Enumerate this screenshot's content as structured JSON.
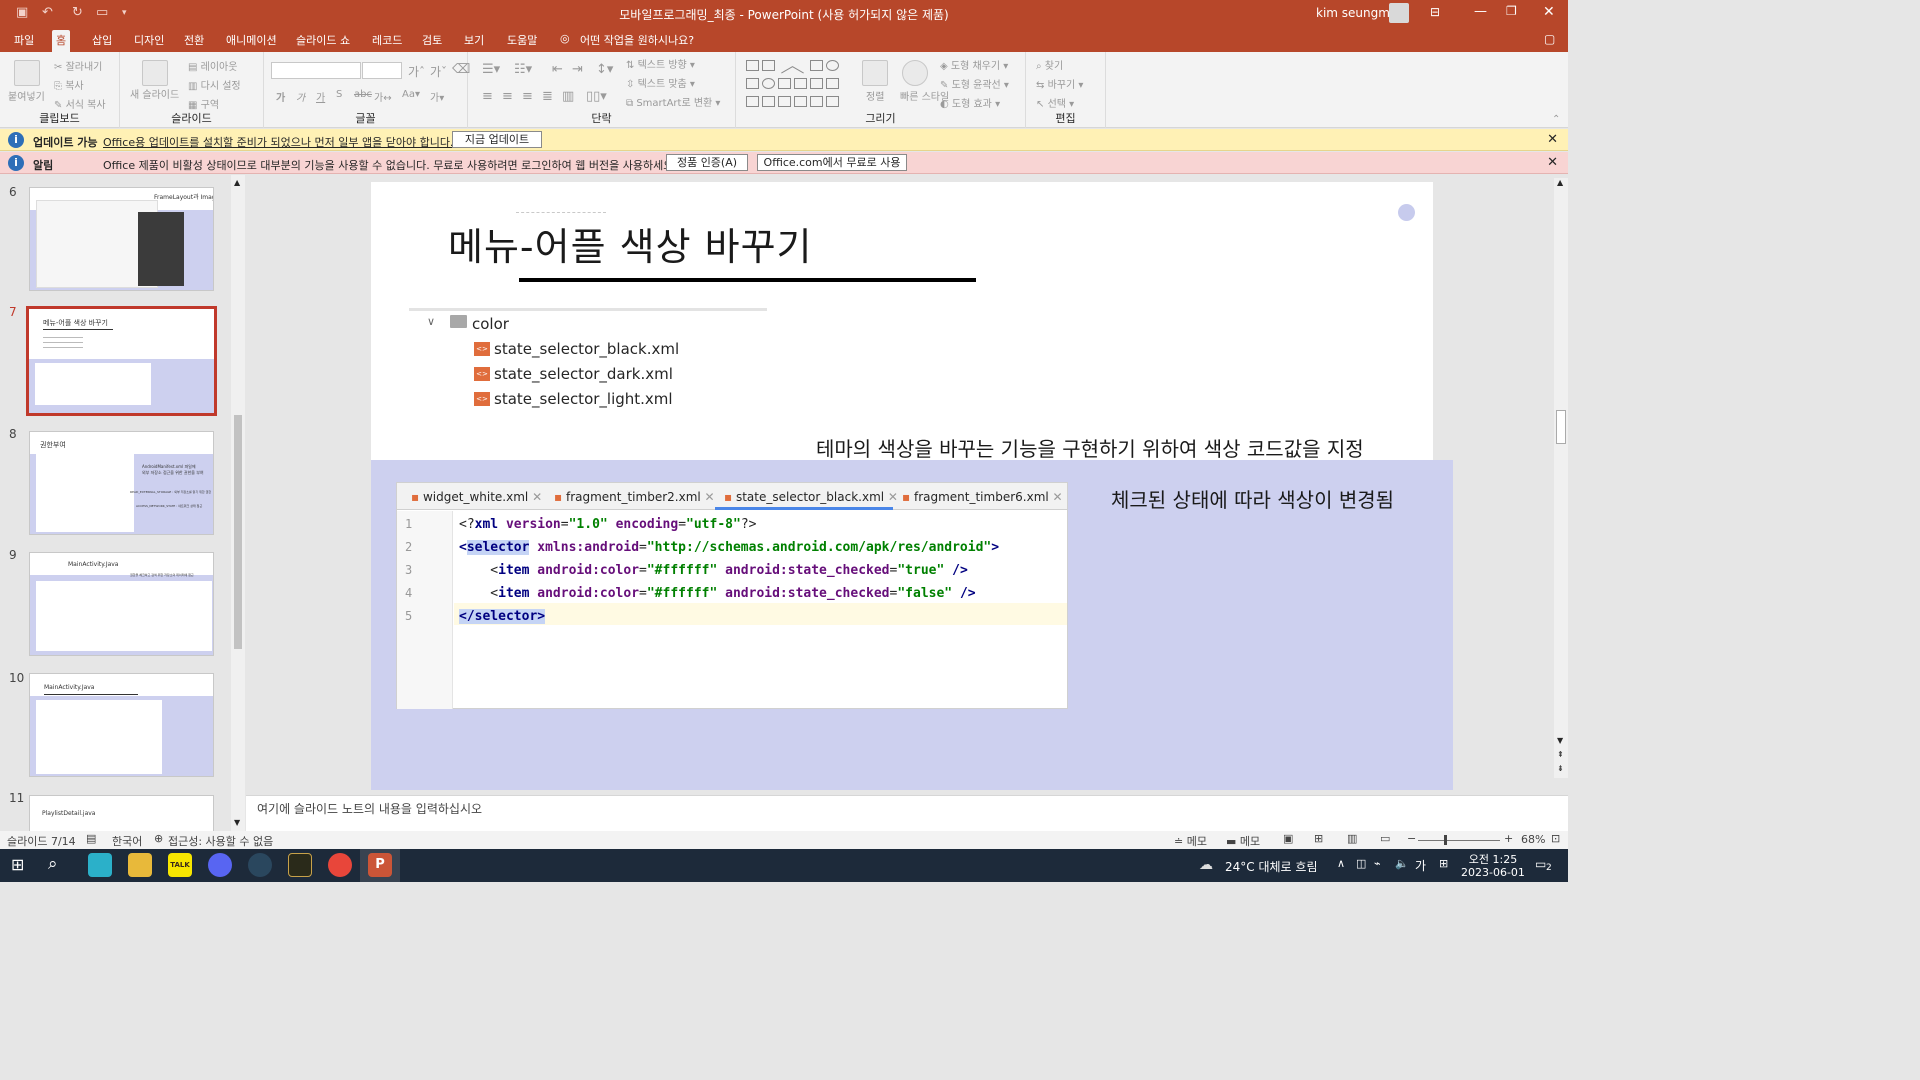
{
  "title_bar": {
    "document": "모바일프로그래밍_최종 - PowerPoint (사용 허가되지 않은 제품)",
    "user": "kim seungmin"
  },
  "menu_tabs": [
    "파일",
    "홈",
    "삽입",
    "디자인",
    "전환",
    "애니메이션",
    "슬라이드 쇼",
    "레코드",
    "검토",
    "보기",
    "도움말"
  ],
  "tell_me": "어떤 작업을 원하시나요?",
  "ribbon": {
    "clipboard": {
      "label": "클립보드",
      "paste": "붙여넣기",
      "cut": "잘라내기",
      "copy": "복사",
      "format": "서식 복사"
    },
    "slides": {
      "label": "슬라이드",
      "new_slide": "새 슬라이드",
      "layout": "레이아웃",
      "reset": "다시 설정",
      "section": "구역"
    },
    "font": {
      "label": "글꼴"
    },
    "paragraph": {
      "label": "단락",
      "text_dir": "텍스트 방향",
      "align_text": "텍스트 맞춤",
      "smartart": "SmartArt로 변환"
    },
    "drawing": {
      "label": "그리기",
      "arrange": "정렬",
      "quick_styles": "빠른 스타일",
      "fill": "도형 채우기",
      "outline": "도형 윤곽선",
      "effects": "도형 효과"
    },
    "editing": {
      "label": "편집",
      "find": "찾기",
      "replace": "바꾸기",
      "select": "선택"
    }
  },
  "update_bar": {
    "title": "업데이트 가능",
    "message": "Office용 업데이트를 설치할 준비가 되었으나 먼저 일부 앱을 닫아야 합니다.",
    "button": "지금 업데이트"
  },
  "alert_bar": {
    "title": "알림",
    "message": "Office 제품이 비활성 상태이므로 대부분의 기능을 사용할 수 없습니다. 무료로 사용하려면 로그인하여 웹 버전을 사용하세요.",
    "button1": "정품 인증(A)",
    "button2": "Office.com에서 무료로 사용"
  },
  "thumbnails": [
    {
      "num": "6",
      "title": "FrameLayout과 ImageView 활용"
    },
    {
      "num": "7",
      "title": "메뉴-어플 색상 바꾸기"
    },
    {
      "num": "8",
      "title": "권한부여",
      "caption1": "AndroidManifest.xml 파일에",
      "caption2": "외부 저장소 접근을 위한 권한을 부여",
      "caption3": "READ_EXTERNAL_STORAGE : 외부 저장소를 읽기 위한 권한",
      "caption4": "ACCESS_NETWORK_STATE : 네트워크 상태 접근"
    },
    {
      "num": "9",
      "title": "MainActivity.Java",
      "caption1": "권한을 체크하고 검색 위한 저장소의 데이터에 접근"
    },
    {
      "num": "10",
      "title": "MainActivity.Java"
    },
    {
      "num": "11",
      "title": "PlaylistDetail.java"
    }
  ],
  "slide": {
    "title": "메뉴-어플 색상 바꾸기",
    "tree": {
      "folder": "color",
      "files": [
        "state_selector_black.xml",
        "state_selector_dark.xml",
        "state_selector_light.xml"
      ]
    },
    "caption1": "테마의 색상을 바꾸는 기능을 구현하기 위하여 색상 코드값을 지정",
    "caption2": "체크된 상태에 따라 색상이 변경됨",
    "editor_tabs": [
      "widget_white.xml",
      "fragment_timber2.xml",
      "state_selector_black.xml",
      "fragment_timber6.xml"
    ],
    "code_lines": [
      {
        "n": "1",
        "parts": [
          {
            "t": "<?",
            "c": ""
          },
          {
            "t": "xml ",
            "c": "kw"
          },
          {
            "t": "version",
            "c": "at"
          },
          {
            "t": "=",
            "c": ""
          },
          {
            "t": "\"1.0\"",
            "c": "str"
          },
          {
            "t": " ",
            "c": ""
          },
          {
            "t": "encoding",
            "c": "at"
          },
          {
            "t": "=",
            "c": ""
          },
          {
            "t": "\"utf-8\"",
            "c": "str"
          },
          {
            "t": "?>",
            "c": ""
          }
        ]
      },
      {
        "n": "2",
        "parts": [
          {
            "t": "<",
            "c": "kw"
          },
          {
            "t": "selector",
            "c": "kw hl"
          },
          {
            "t": " ",
            "c": ""
          },
          {
            "t": "xmlns:android",
            "c": "at"
          },
          {
            "t": "=",
            "c": ""
          },
          {
            "t": "\"http://schemas.android.com/apk/res/android\"",
            "c": "str"
          },
          {
            "t": ">",
            "c": "kw"
          }
        ]
      },
      {
        "n": "3",
        "parts": [
          {
            "t": "    <",
            "c": ""
          },
          {
            "t": "item ",
            "c": "kw"
          },
          {
            "t": "android:color",
            "c": "at"
          },
          {
            "t": "=",
            "c": ""
          },
          {
            "t": "\"#ffffff\"",
            "c": "str"
          },
          {
            "t": " ",
            "c": ""
          },
          {
            "t": "android:state_checked",
            "c": "at"
          },
          {
            "t": "=",
            "c": ""
          },
          {
            "t": "\"true\"",
            "c": "str"
          },
          {
            "t": " />",
            "c": "kw"
          }
        ]
      },
      {
        "n": "4",
        "parts": [
          {
            "t": "    <",
            "c": ""
          },
          {
            "t": "item ",
            "c": "kw"
          },
          {
            "t": "android:color",
            "c": "at"
          },
          {
            "t": "=",
            "c": ""
          },
          {
            "t": "\"#ffffff\"",
            "c": "str"
          },
          {
            "t": " ",
            "c": ""
          },
          {
            "t": "android:state_checked",
            "c": "at"
          },
          {
            "t": "=",
            "c": ""
          },
          {
            "t": "\"false\"",
            "c": "str"
          },
          {
            "t": " />",
            "c": "kw"
          }
        ]
      },
      {
        "n": "5",
        "parts": [
          {
            "t": "</selector>",
            "c": "kw hl"
          }
        ]
      }
    ]
  },
  "notes_placeholder": "여기에 슬라이드 노트의 내용을 입력하십시오",
  "status": {
    "slide": "슬라이드 7/14",
    "lang": "한국어",
    "access": "접근성: 사용할 수 없음",
    "notes1": "메모",
    "notes2": "메모",
    "zoom": "68%"
  },
  "taskbar": {
    "weather": "24°C 대체로 흐림",
    "ime": "가",
    "time": "오전 1:25",
    "date": "2023-06-01",
    "notif": "2"
  }
}
